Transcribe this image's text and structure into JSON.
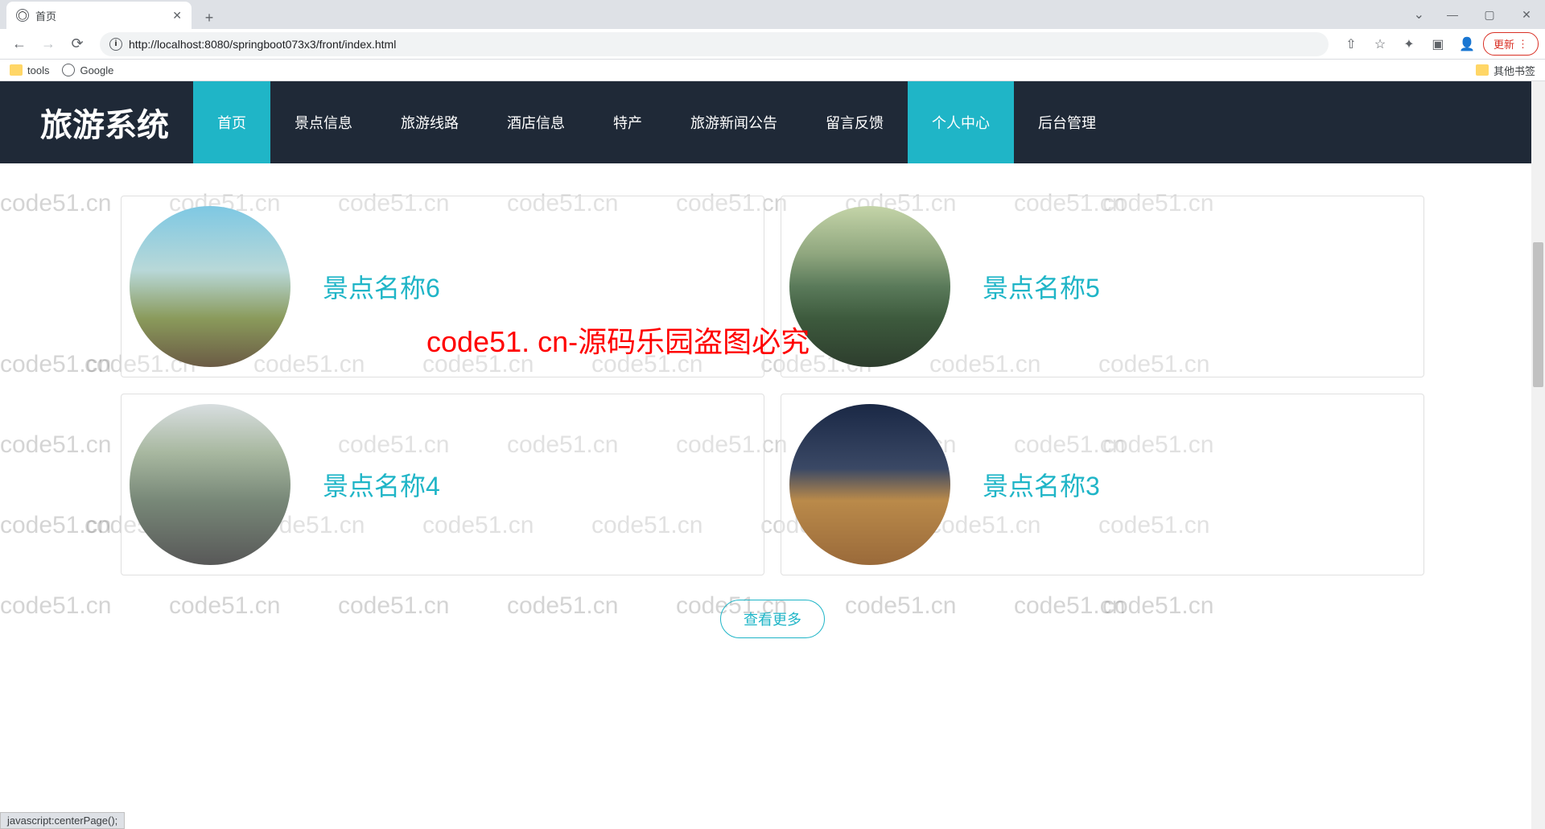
{
  "browser": {
    "tab_title": "首页",
    "url": "http://localhost:8080/springboot073x3/front/index.html",
    "bookmarks": {
      "tools": "tools",
      "google": "Google",
      "other": "其他书签"
    },
    "update_label": "更新",
    "status_text": "javascript:centerPage();"
  },
  "site": {
    "brand": "旅游系统",
    "nav": [
      {
        "label": "首页",
        "active": true
      },
      {
        "label": "景点信息",
        "active": false
      },
      {
        "label": "旅游线路",
        "active": false
      },
      {
        "label": "酒店信息",
        "active": false
      },
      {
        "label": "特产",
        "active": false
      },
      {
        "label": "旅游新闻公告",
        "active": false
      },
      {
        "label": "留言反馈",
        "active": false
      },
      {
        "label": "个人中心",
        "active": true
      },
      {
        "label": "后台管理",
        "active": false
      }
    ]
  },
  "cards": [
    {
      "title": "景点名称6",
      "img": "img1"
    },
    {
      "title": "景点名称5",
      "img": "img2"
    },
    {
      "title": "景点名称4",
      "img": "img3"
    },
    {
      "title": "景点名称3",
      "img": "img4"
    }
  ],
  "more_button": "查看更多",
  "watermark": "code51.cn",
  "watermark_red": "code51. cn-源码乐园盗图必究"
}
